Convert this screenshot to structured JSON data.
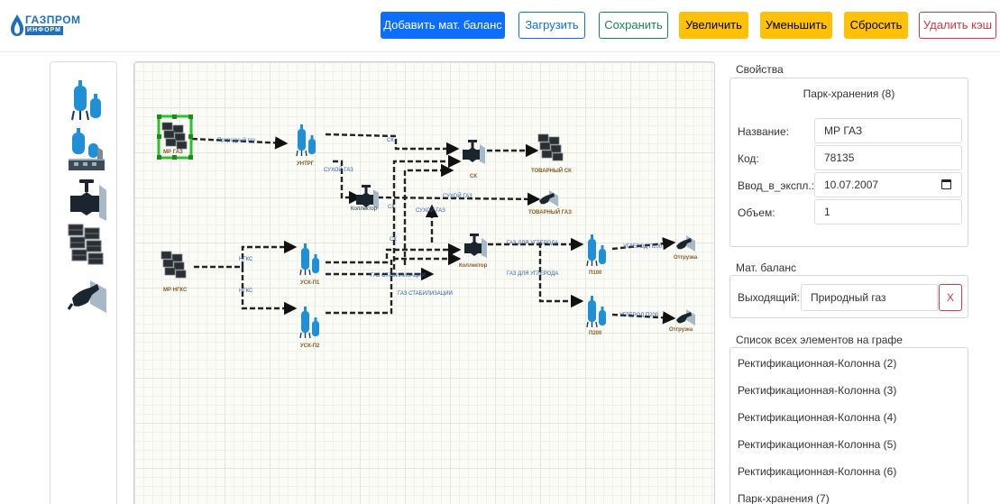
{
  "brand": {
    "name_top": "ГАЗПРОМ",
    "name_bottom": "ИНФОРМ"
  },
  "toolbar": {
    "add_balance": "Добавить мат. баланс",
    "load": "Загрузить",
    "save": "Сохранить",
    "zoom_in": "Увеличить",
    "zoom_out": "Уменьшить",
    "reset": "Сбросить",
    "clear_cache": "Удалить кэш"
  },
  "palette": {
    "items": [
      "rectification-column-icon",
      "processing-unit-icon",
      "valve-icon",
      "storage-park-icon",
      "fuel-nozzle-icon"
    ]
  },
  "graph": {
    "nodes": {
      "mr_gaz": "МР ГАЗ",
      "untrg": "УНТРГ",
      "collector1": "Коллектор",
      "sk": "СК",
      "tovarny_sk": "ТОВАРНЫЙ СК",
      "tovarny_gaz": "ТОВАРНЫЙ ГАЗ",
      "mr_ngks": "МР НГКС",
      "usk1": "УСК-П1",
      "usk2": "УСК-П2",
      "collector2": "Коллектор",
      "p100": "П100",
      "p200": "П200",
      "otgruzka1": "Отгрузка",
      "otgruzka2": "Отгрузка"
    },
    "edges": {
      "prirodny_gaz": "Природный газ",
      "sukhoy_gaz_1": "СУХОЙ ГАЗ",
      "sukhoy_gaz_2": "СУХОЙ ГАЗ",
      "sukhoy_gaz_3": "СУХОЙ ГАЗ",
      "sk_small_1": "СК",
      "sk_small_2": "СК",
      "sk_small_3": "СК",
      "ngks_1": "НГКС",
      "ngks_2": "НГКС",
      "gaz_stab_1": "ГАЗ СТАБИЛИЗАЦИИ",
      "gaz_stab_2": "ГАЗ СТАБИЛИЗАЦИИ",
      "gaz_uglerod_1": "ГАЗ ДЛЯ УГЛЕРОДА",
      "gaz_uglerod_2": "ГАЗ ДЛЯ УГЛЕРОДА",
      "uglerod_p100": "УГЛЕРОД П100",
      "uglerod_p200": "УГЛЕРОД П200"
    }
  },
  "properties": {
    "title": "Свойства",
    "header": "Парк-хранения (8)",
    "fields": [
      {
        "label": "Название:",
        "value": "МР ГАЗ"
      },
      {
        "label": "Код:",
        "value": "78135"
      },
      {
        "label": "Ввод_в_экспл.:",
        "value": "10.07.2007"
      },
      {
        "label": "Объем:",
        "value": "1"
      }
    ]
  },
  "balance": {
    "title": "Мат. баланс",
    "label": "Выходящий:",
    "value": "Природный газ",
    "remove": "X"
  },
  "elements": {
    "title": "Список всех элементов на графе",
    "items": [
      "Ректификационная-Колонна (2)",
      "Ректификационная-Колонна (3)",
      "Ректификационная-Колонна (4)",
      "Ректификационная-Колонна (5)",
      "Ректификационная-Колонна (6)",
      "Парк-хранения (7)"
    ]
  },
  "colors": {
    "primary": "#0d6efd",
    "success": "#198754",
    "warning": "#ffc107",
    "danger": "#dc3545",
    "equipment": "#1f8fd6"
  }
}
